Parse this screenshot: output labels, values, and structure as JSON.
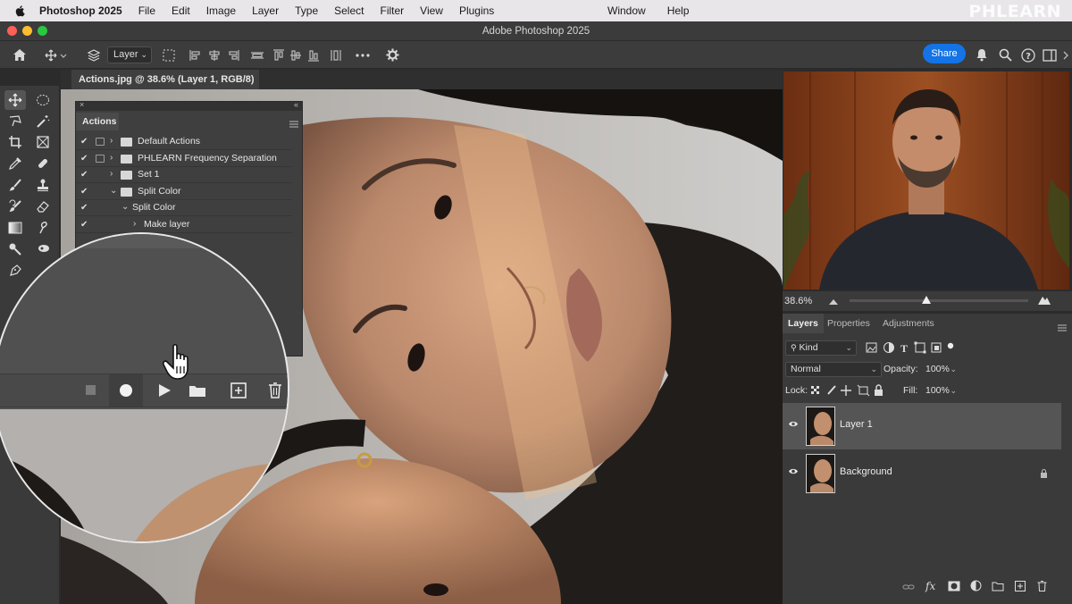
{
  "menubar": {
    "app_name": "Photoshop 2025",
    "menus": [
      "File",
      "Edit",
      "Image",
      "Layer",
      "Type",
      "Select",
      "Filter",
      "View",
      "Plugins"
    ],
    "right_menus": [
      "Window",
      "Help"
    ],
    "brand": "PHLEARN"
  },
  "window": {
    "title": "Adobe Photoshop 2025"
  },
  "options_bar": {
    "layer_select": "Layer",
    "share_label": "Share"
  },
  "document": {
    "tab_title": "Actions.jpg @ 38.6% (Layer 1, RGB/8) *"
  },
  "actions_panel": {
    "tab": "Actions",
    "rows": [
      {
        "label": "Default Actions",
        "checked": true,
        "dialog": true,
        "folder": true,
        "level": 0,
        "caret": "›"
      },
      {
        "label": "PHLEARN Frequency Separation",
        "checked": true,
        "dialog": true,
        "folder": true,
        "level": 0,
        "caret": "›"
      },
      {
        "label": "Set 1",
        "checked": true,
        "dialog": false,
        "folder": true,
        "level": 0,
        "caret": "›"
      },
      {
        "label": "Split Color",
        "checked": true,
        "dialog": false,
        "folder": true,
        "level": 0,
        "caret": "⌄"
      },
      {
        "label": "Split Color",
        "checked": true,
        "dialog": false,
        "folder": false,
        "level": 1,
        "caret": "⌄"
      },
      {
        "label": "Make layer",
        "checked": true,
        "dialog": false,
        "folder": false,
        "level": 2,
        "caret": "›"
      }
    ]
  },
  "zoom": {
    "level": "38.6%"
  },
  "layers_panel": {
    "tabs": [
      "Layers",
      "Properties",
      "Adjustments"
    ],
    "kind": "Kind",
    "blend_mode": "Normal",
    "opacity_label": "Opacity:",
    "opacity_value": "100%",
    "lock_label": "Lock:",
    "fill_label": "Fill:",
    "fill_value": "100%",
    "layers": [
      {
        "name": "Layer 1",
        "selected": true,
        "locked": false
      },
      {
        "name": "Background",
        "selected": false,
        "locked": true
      }
    ]
  },
  "colors": {
    "accent": "#1473e6",
    "panel": "#3a3a3a",
    "selected_row": "#555555"
  }
}
